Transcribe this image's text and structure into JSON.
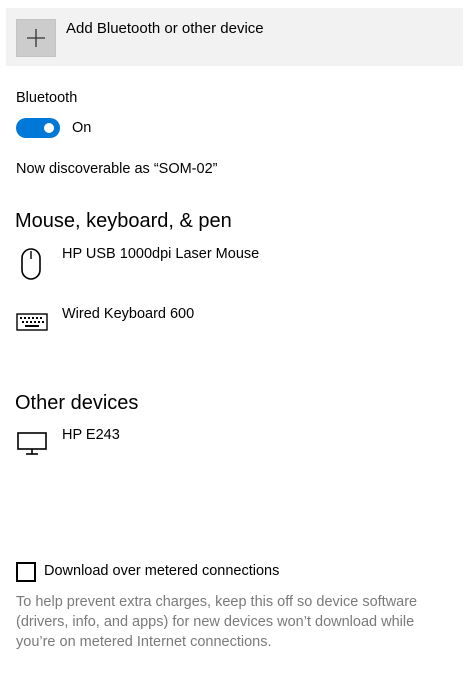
{
  "add_device": {
    "label": "Add Bluetooth or other device",
    "icon": "plus-icon"
  },
  "bluetooth": {
    "label": "Bluetooth",
    "toggle_state": "On",
    "enabled": true,
    "accent": "#0078d7"
  },
  "discoverable_text": "Now discoverable as “SOM-02”",
  "sections": {
    "mouse_keyboard": {
      "title": "Mouse, keyboard, & pen",
      "devices": [
        {
          "name": "HP USB 1000dpi Laser Mouse",
          "icon": "mouse-icon"
        },
        {
          "name": "Wired Keyboard 600",
          "icon": "keyboard-icon"
        }
      ]
    },
    "other": {
      "title": "Other devices",
      "devices": [
        {
          "name": "HP E243",
          "icon": "monitor-icon"
        }
      ]
    }
  },
  "metered": {
    "checkbox_label": "Download over metered connections",
    "checked": false,
    "help_text": "To help prevent extra charges, keep this off so device software (drivers, info, and apps) for new devices won’t download while you’re on metered Internet connections."
  }
}
